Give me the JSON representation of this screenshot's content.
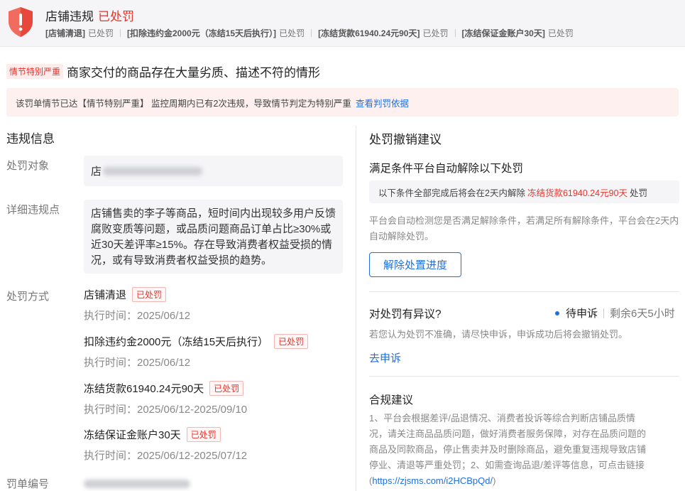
{
  "header": {
    "title": "店铺违规",
    "status": "已处罚",
    "summary": [
      {
        "label": "[店铺清退]",
        "status": "已处罚"
      },
      {
        "label": "[扣除违约金2000元（冻结15天后执行）]",
        "status": "已处罚"
      },
      {
        "label": "[冻结货款61940.24元90天]",
        "status": "已处罚"
      },
      {
        "label": "[冻结保证金账户30天]",
        "status": "已处罚"
      }
    ]
  },
  "reason": {
    "severity_tag": "情节特别严重",
    "text": "商家交付的商品存在大量劣质、描述不符的情形"
  },
  "alert": {
    "text": "该罚单情节已达【情节特别严重】 监控周期内已有2次违规，导致情节判定为特别严重",
    "link": "查看判罚依据"
  },
  "violation": {
    "title": "违规信息",
    "target_label": "处罚对象",
    "target_value": "店",
    "detail_label": "详细违规点",
    "detail_text": "店铺售卖的李子等商品，短时间内出现较多用户反馈腐败变质等问题，或品质问题商品订单占比≥30%或近30天差评率≥15%。存在导致消费者权益受损的情况，或有导致消费者权益受损的趋势。",
    "method_label": "处罚方式",
    "penalties": [
      {
        "name": "店铺清退",
        "tag": "已处罚",
        "time": "执行时间：2025/06/12"
      },
      {
        "name": "扣除违约金2000元（冻结15天后执行）",
        "tag": "已处罚",
        "time": "执行时间：2025/06/12"
      },
      {
        "name": "冻结货款61940.24元90天",
        "tag": "已处罚",
        "time": "执行时间：2025/06/12-2025/09/10"
      },
      {
        "name": "冻结保证金账户30天",
        "tag": "已处罚",
        "time": "执行时间：2025/06/12-2025/07/12"
      }
    ],
    "ticket_label": "罚单编号"
  },
  "revoke": {
    "title": "处罚撤销建议",
    "auto_title": "满足条件平台自动解除以下处罚",
    "cond_prefix": "以下条件全部完成后将会在2天内解除",
    "cond_highlight": "冻结货款61940.24元90天",
    "cond_suffix": "处罚",
    "auto_desc": "平台会自动检测您是否满足解除条件，若满足所有解除条件，平台会在2天内自动解除处罚。",
    "progress_button": "解除处置进度"
  },
  "appeal": {
    "title": "对处罚有异议?",
    "status": "待申诉",
    "remaining": "剩余6天5小时",
    "desc": "若您认为处罚不准确，请尽快申诉，申诉成功后将会撤销处罚。",
    "link": "去申诉"
  },
  "compliance": {
    "title": "合规建议",
    "text_lines": [
      "1、平台会根据差评/品退情况、消费者投诉等综合判断店铺品质情",
      "况，请关注商品品质问题，做好消费者服务保障，对存在品质问题的",
      "商品及同款商品，停止售卖并及时删除商品，避免重复违规导致店铺",
      "停业、清退等严重处罚；2、如需查询品退/差评等信息，可点击链接"
    ],
    "link_open": "(",
    "link": "https://zjsms.com/i2HCBpQd/",
    "link_close": ")"
  },
  "colors": {
    "accent_red": "#e8332b",
    "accent_blue": "#1f6fe0"
  }
}
